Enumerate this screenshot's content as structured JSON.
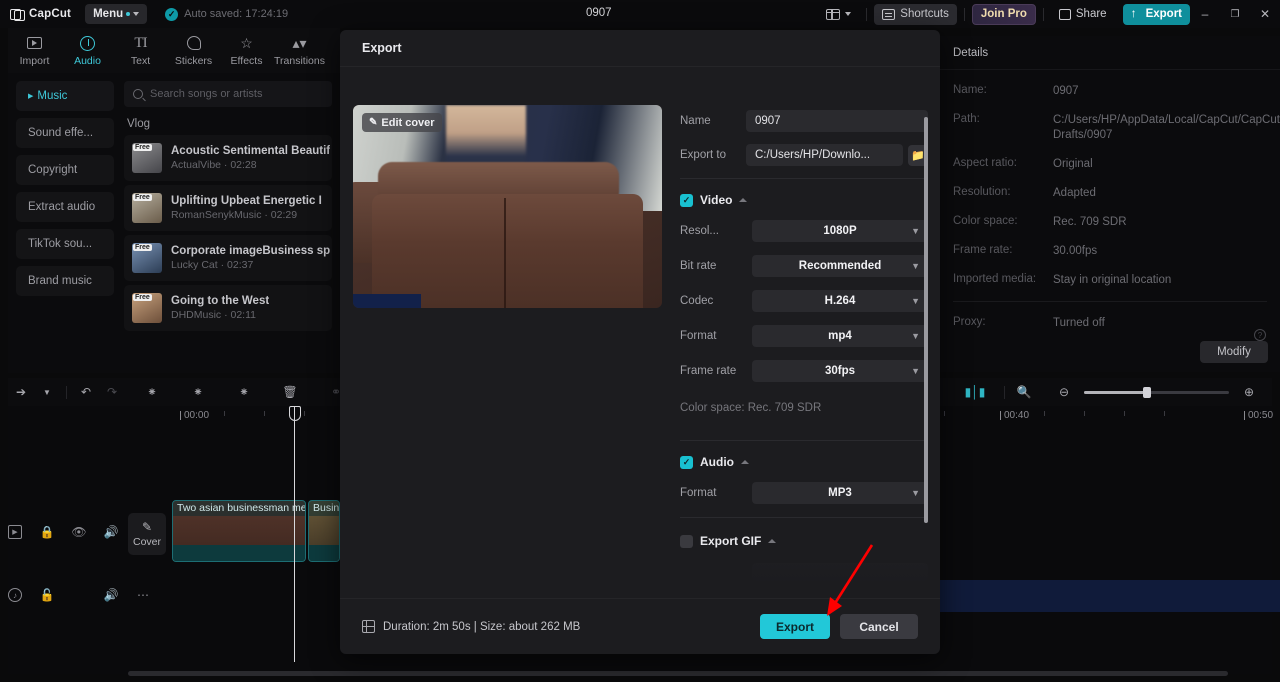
{
  "titlebar": {
    "app_name": "CapCut",
    "menu_label": "Menu",
    "autosave": "Auto saved: 17:24:19",
    "project_title": "0907",
    "shortcuts": "Shortcuts",
    "join_pro": "Join Pro",
    "share": "Share",
    "export": "Export",
    "minimize": "–",
    "maximize": "❐",
    "close": "✕",
    "accent_teal": "#0f8f9c"
  },
  "tooltabs": [
    {
      "label": "Import",
      "icon": "import-icon",
      "active": false
    },
    {
      "label": "Audio",
      "icon": "audio-icon",
      "active": true
    },
    {
      "label": "Text",
      "icon": "text-icon",
      "active": false
    },
    {
      "label": "Stickers",
      "icon": "stickers-icon",
      "active": false
    },
    {
      "label": "Effects",
      "icon": "effects-icon",
      "active": false
    },
    {
      "label": "Transitions",
      "icon": "transitions-icon",
      "active": false
    }
  ],
  "library": {
    "categories": [
      {
        "label": "Music",
        "active": true
      },
      {
        "label": "Sound effe...",
        "active": false
      },
      {
        "label": "Copyright",
        "active": false
      },
      {
        "label": "Extract audio",
        "active": false
      },
      {
        "label": "TikTok sou...",
        "active": false
      },
      {
        "label": "Brand music",
        "active": false
      }
    ],
    "search_placeholder": "Search songs or artists",
    "section_title": "Vlog",
    "badge": "Free",
    "songs": [
      {
        "title": "Acoustic Sentimental Beautif",
        "sub": "ActualVibe · 02:28"
      },
      {
        "title": "Uplifting Upbeat Energetic I",
        "sub": "RomanSenykMusic · 02:29"
      },
      {
        "title": "Corporate imageBusiness sp",
        "sub": "Lucky Cat · 02:37"
      },
      {
        "title": "Going to the West",
        "sub": "DHDMusic · 02:11"
      }
    ]
  },
  "timeline": {
    "ruler_labels": [
      "00:00",
      "00:40",
      "00:50"
    ],
    "cover_label": "Cover",
    "clips": [
      {
        "label": "Two asian businessman me"
      },
      {
        "label": "Busine"
      }
    ]
  },
  "details": {
    "heading": "Details",
    "rows": [
      {
        "key": "Name:",
        "value": "0907"
      },
      {
        "key": "Path:",
        "value": "C:/Users/HP/AppData/Local/CapCut/CapCut Drafts/0907"
      },
      {
        "key": "Aspect ratio:",
        "value": "Original"
      },
      {
        "key": "Resolution:",
        "value": "Adapted"
      },
      {
        "key": "Color space:",
        "value": "Rec. 709 SDR"
      },
      {
        "key": "Frame rate:",
        "value": "30.00fps"
      },
      {
        "key": "Imported media:",
        "value": "Stay in original location"
      },
      {
        "key": "Proxy:",
        "value": "Turned off"
      }
    ],
    "modify_label": "Modify"
  },
  "export_dialog": {
    "title": "Export",
    "edit_cover": "Edit cover",
    "name_label": "Name",
    "name_value": "0907",
    "export_to_label": "Export to",
    "export_to_value": "C:/Users/HP/Downlo...",
    "video": {
      "section": "Video",
      "enabled": true,
      "fields": [
        {
          "label": "Resol...",
          "value": "1080P"
        },
        {
          "label": "Bit rate",
          "value": "Recommended"
        },
        {
          "label": "Codec",
          "value": "H.264"
        },
        {
          "label": "Format",
          "value": "mp4"
        },
        {
          "label": "Frame rate",
          "value": "30fps"
        }
      ],
      "color_space": "Color space: Rec. 709 SDR"
    },
    "audio": {
      "section": "Audio",
      "enabled": true,
      "fields": [
        {
          "label": "Format",
          "value": "MP3"
        }
      ]
    },
    "gif": {
      "section": "Export GIF",
      "enabled": false
    },
    "footer": {
      "duration_size": "Duration: 2m 50s | Size: about 262 MB",
      "export_label": "Export",
      "cancel_label": "Cancel",
      "export_color": "#22c8d8"
    }
  },
  "annotation": {
    "arrow_color": "#ff0000"
  }
}
